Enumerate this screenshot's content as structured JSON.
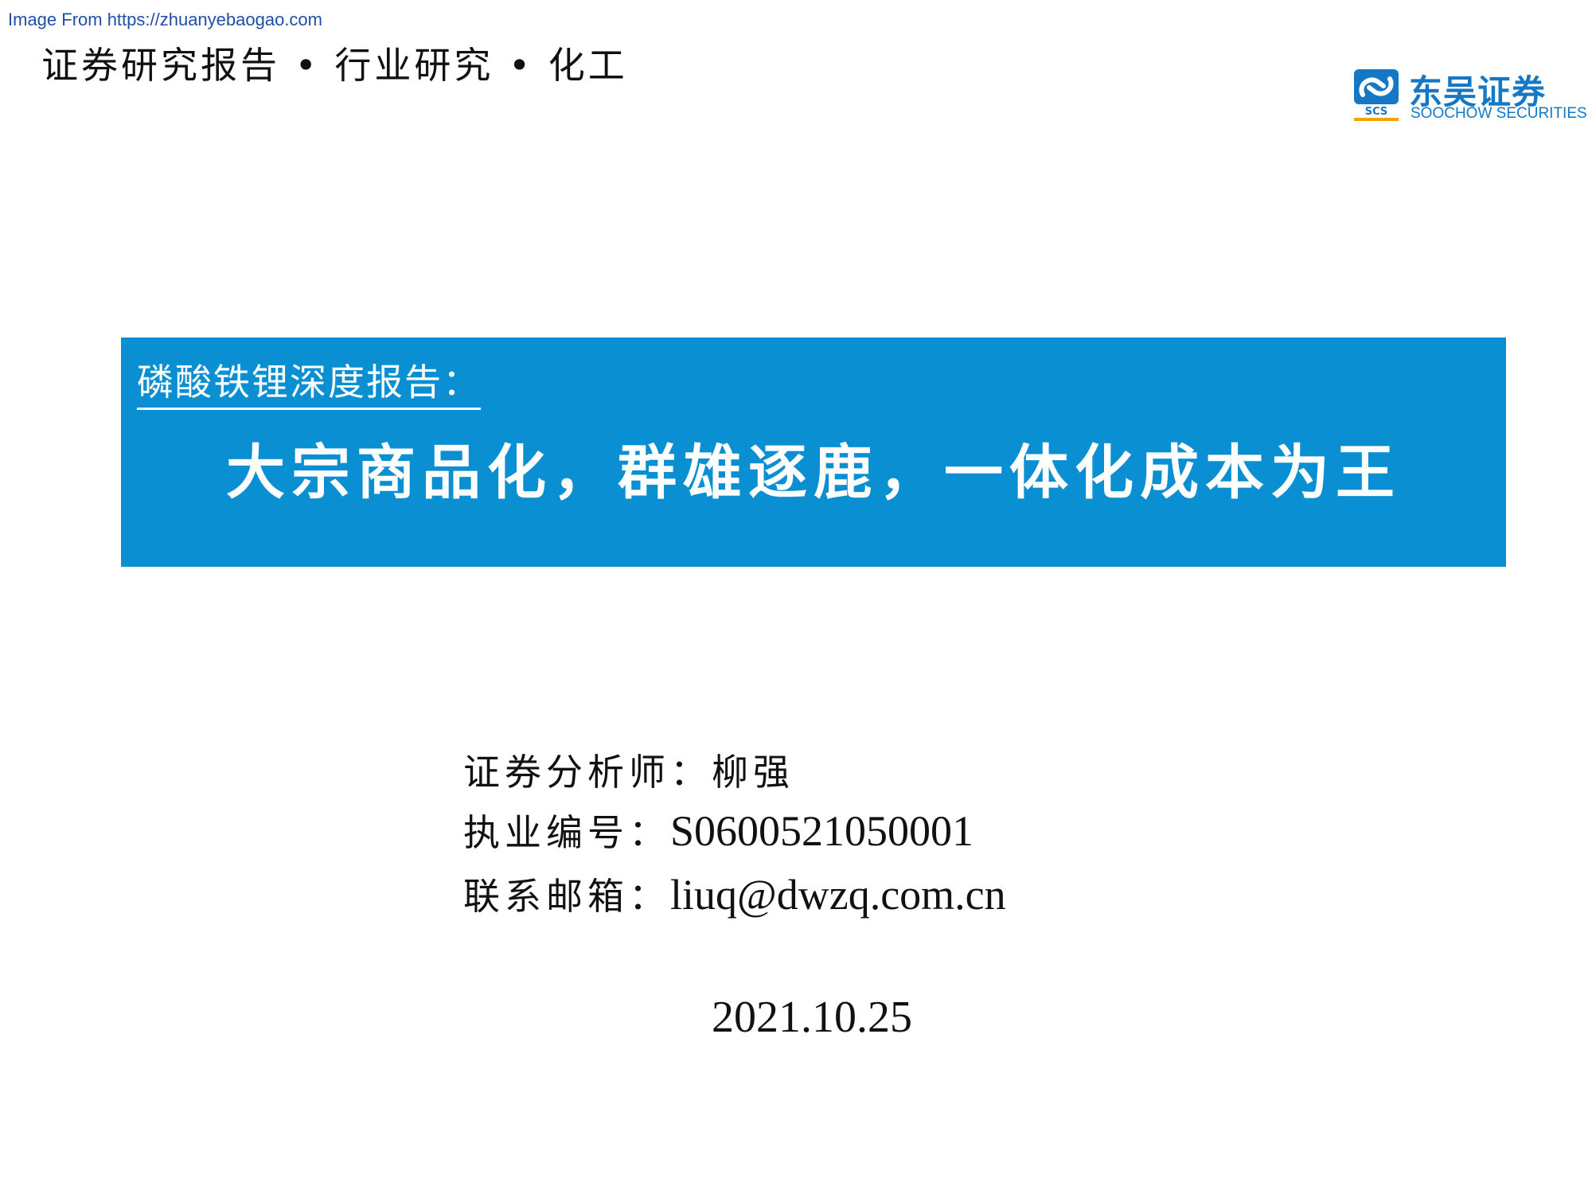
{
  "watermark": "Image From https://zhuanyebaogao.com",
  "header": "证券研究报告 • 行业研究 • 化工",
  "logo": {
    "icon": "soochow-logo-icon",
    "mark_text": "SCS",
    "name_cn": "东吴证券",
    "name_en": "SOOCHOW SECURITIES",
    "colors": {
      "blue": "#1478c4",
      "orange": "#f5a300"
    }
  },
  "banner": {
    "background": "#0a90d2",
    "subtitle": "磷酸铁锂深度报告：",
    "title": "大宗商品化，群雄逐鹿，一体化成本为王"
  },
  "analyst": {
    "label": "证券分析师：",
    "value": "柳强"
  },
  "license": {
    "label": "执业编号：",
    "value": "S0600521050001"
  },
  "email": {
    "label": "联系邮箱：",
    "value": "liuq@dwzq.com.cn"
  },
  "date": "2021.10.25"
}
